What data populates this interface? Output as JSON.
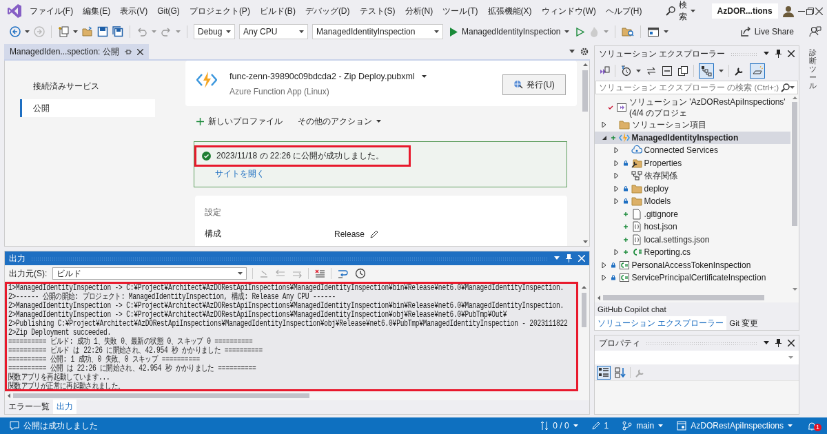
{
  "title_bar": {
    "menu": [
      "ファイル(F)",
      "編集(E)",
      "表示(V)",
      "Git(G)",
      "プロジェクト(P)",
      "ビルド(B)",
      "デバッグ(D)",
      "テスト(S)",
      "分析(N)",
      "ツール(T)",
      "拡張機能(X)",
      "ウィンドウ(W)",
      "ヘルプ(H)"
    ],
    "search": "検索",
    "solution_badge": "AzDOR...tions"
  },
  "toolbar": {
    "configuration": "Debug",
    "platform": "Any CPU",
    "startup_project": "ManagedIdentityInspection",
    "run_target": "ManagedIdentityInspection",
    "live_share": "Live Share"
  },
  "document_tab": {
    "title": "ManagedIden...spection: 公開"
  },
  "publish": {
    "nav": [
      {
        "label": "接続済みサービス",
        "selected": false
      },
      {
        "label": "公開",
        "selected": true
      }
    ],
    "profile": "func-zenn-39890c09bdcda2 - Zip Deploy.pubxml",
    "profile_type": "Azure Function App (Linux)",
    "publish_button": "発行(U)",
    "new_profile": "新しいプロファイル",
    "more_actions": "その他のアクション",
    "status_message": "2023/11/18 の 22:26 に公開が成功しました。",
    "open_site": "サイトを開く",
    "settings_title": "設定",
    "settings": [
      {
        "label": "構成",
        "value": "Release"
      }
    ]
  },
  "output": {
    "title": "出力",
    "source_label": "出力元(S):",
    "source": "ビルド",
    "lines": [
      "1>ManagedIdentityInspection -> C:¥Project¥Architect¥AzDORestApiInspections¥ManagedIdentityInspection¥bin¥Release¥net6.0¥ManagedIdentityInspection.",
      "2>------ 公開の開始: プロジェクト: ManagedIdentityInspection, 構成: Release Any CPU ------",
      "2>ManagedIdentityInspection -> C:¥Project¥Architect¥AzDORestApiInspections¥ManagedIdentityInspection¥bin¥Release¥net6.0¥ManagedIdentityInspection.",
      "2>ManagedIdentityInspection -> C:¥Project¥Architect¥AzDORestApiInspections¥ManagedIdentityInspection¥obj¥Release¥net6.0¥PubTmp¥Out¥",
      "2>Publishing C:¥Project¥Architect¥AzDORestApiInspections¥ManagedIdentityInspection¥obj¥Release¥net6.0¥PubTmp¥ManagedIdentityInspection - 2023111822",
      "2>Zip Deployment succeeded.",
      "========== ビルド: 成功 1、失敗 0、最新の状態 0、スキップ 0 ==========",
      "========== ビルド は 22:26 に開始され、42.954 秒 かかりました ==========",
      "========== 公開: 1 成功、0 失敗、0 スキップ ==========",
      "========== 公開 は 22:26 に開始され、42.954 秒 かかりました ==========",
      "関数アプリを再起動しています...",
      "関数アプリが正常に再起動されました。"
    ]
  },
  "bottom_tabs": [
    {
      "label": "エラー一覧",
      "selected": false
    },
    {
      "label": "出力",
      "selected": true
    }
  ],
  "solution_explorer": {
    "title": "ソリューション エクスプローラー",
    "search_placeholder": "ソリューション エクスプローラー の検索 (Ctrl+;)",
    "tree": [
      {
        "label": "ソリューション 'AzDORestApiInspections' (4/4 のプロジェ",
        "kind": "solution",
        "modified": true,
        "added": false,
        "unchanged": false,
        "selected": false,
        "children": [
          {
            "label": "ソリューション項目",
            "kind": "folder",
            "modified": false,
            "added": false,
            "unchanged": false,
            "expanded": false,
            "selected": false
          },
          {
            "label": "ManagedIdentityInspection",
            "kind": "function",
            "modified": false,
            "added": true,
            "unchanged": false,
            "expanded": true,
            "selected": true,
            "children": [
              {
                "label": "Connected Services",
                "kind": "connected",
                "modified": false,
                "added": false,
                "unchanged": false,
                "expanded": false,
                "selected": false
              },
              {
                "label": "Properties",
                "kind": "properties",
                "modified": false,
                "added": false,
                "unchanged": true,
                "expanded": false,
                "selected": false
              },
              {
                "label": "依存関係",
                "kind": "dependencies",
                "modified": false,
                "added": false,
                "unchanged": false,
                "expanded": false,
                "selected": false
              },
              {
                "label": "deploy",
                "kind": "folder",
                "modified": false,
                "added": false,
                "unchanged": true,
                "expanded": false,
                "selected": false
              },
              {
                "label": "Models",
                "kind": "folder",
                "modified": false,
                "added": false,
                "unchanged": true,
                "expanded": false,
                "selected": false
              },
              {
                "label": ".gitignore",
                "kind": "file",
                "modified": false,
                "added": true,
                "unchanged": false,
                "selected": false
              },
              {
                "label": "host.json",
                "kind": "json",
                "modified": false,
                "added": true,
                "unchanged": false,
                "selected": false
              },
              {
                "label": "local.settings.json",
                "kind": "json",
                "modified": false,
                "added": true,
                "unchanged": false,
                "selected": false
              },
              {
                "label": "Reporting.cs",
                "kind": "csharp",
                "modified": false,
                "added": true,
                "unchanged": false,
                "expanded": false,
                "selected": false
              }
            ]
          },
          {
            "label": "PersonalAccessTokenInspection",
            "kind": "csproj",
            "modified": false,
            "added": false,
            "unchanged": true,
            "expanded": false,
            "selected": false
          },
          {
            "label": "ServicePrincipalCertificateInspection",
            "kind": "csproj",
            "modified": false,
            "added": false,
            "unchanged": true,
            "expanded": false,
            "selected": false
          }
        ]
      }
    ],
    "tabs": [
      {
        "label": "GitHub Copilot chat",
        "selected": false
      },
      {
        "label": "ソリューション エクスプローラー",
        "selected": true
      },
      {
        "label": "Git 変更",
        "selected": false
      }
    ]
  },
  "properties": {
    "title": "プロパティ"
  },
  "side_tab": "診断ツール",
  "status_bar": {
    "message": "公開は成功しました",
    "changes": "0 / 0",
    "pending": "1",
    "branch": "main",
    "repository": "AzDORestApiInspections",
    "notifications": "1"
  }
}
